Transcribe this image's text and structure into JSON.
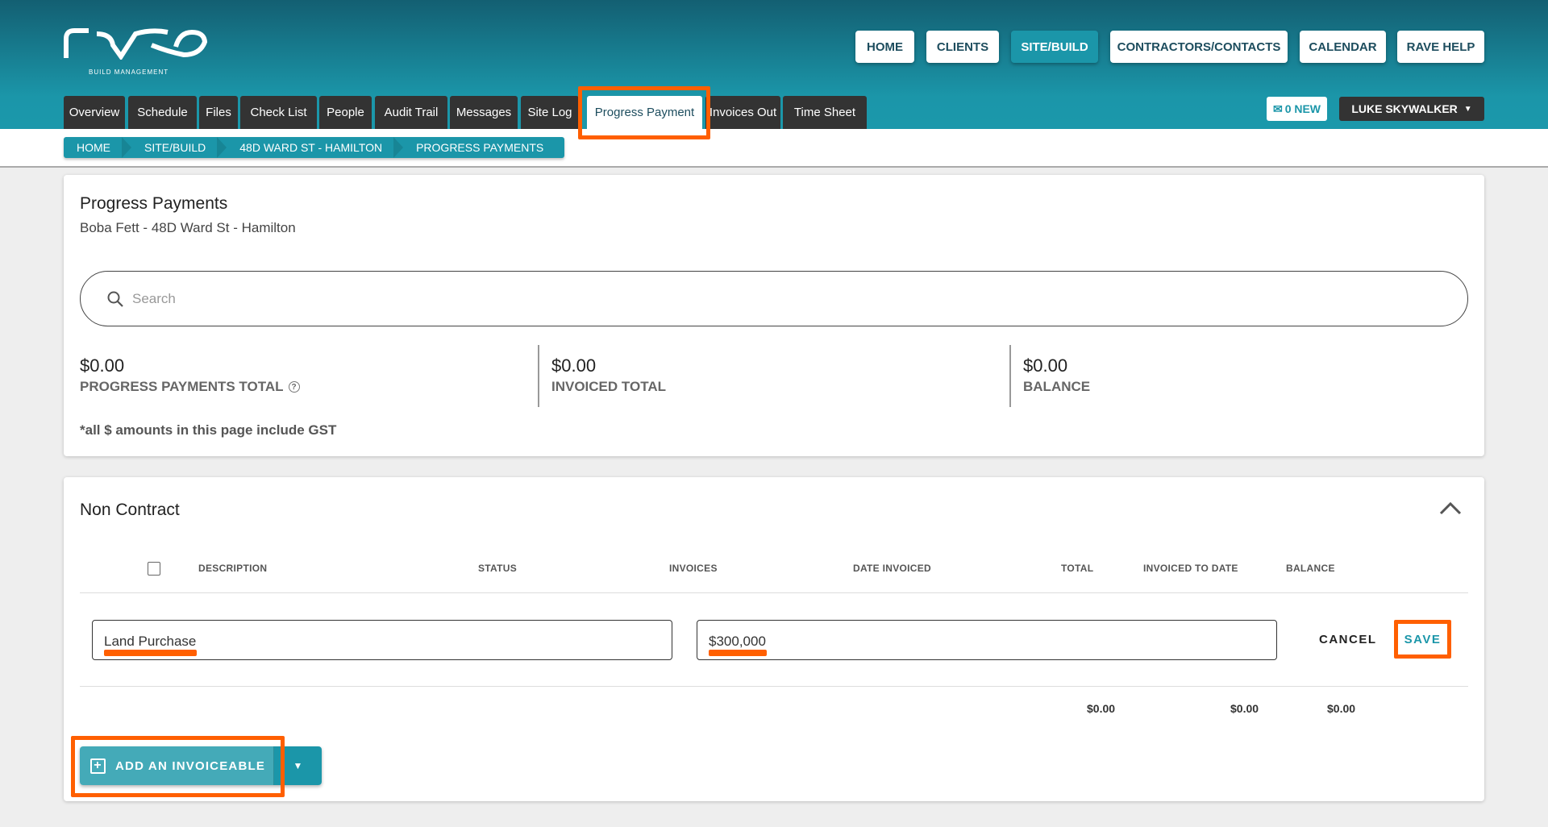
{
  "logo": {
    "text": "rave",
    "tagline": "BUILD MANAGEMENT"
  },
  "nav": [
    {
      "label": "HOME"
    },
    {
      "label": "CLIENTS"
    },
    {
      "label": "SITE/BUILD",
      "active": true
    },
    {
      "label": "CONTRACTORS/CONTACTS"
    },
    {
      "label": "CALENDAR"
    },
    {
      "label": "RAVE HELP"
    }
  ],
  "tabs": [
    "Overview",
    "Schedule",
    "Files",
    "Check List",
    "People",
    "Audit Trail",
    "Messages",
    "Site Log",
    "Progress Payment",
    "Invoices Out",
    "Time Sheet"
  ],
  "messages": {
    "label": "0 NEW"
  },
  "user": {
    "name": "LUKE SKYWALKER"
  },
  "breadcrumb": [
    "HOME",
    "SITE/BUILD",
    "48D WARD ST - HAMILTON",
    "PROGRESS PAYMENTS"
  ],
  "summary": {
    "title": "Progress Payments",
    "subtitle": "Boba Fett - 48D Ward St - Hamilton",
    "search_placeholder": "Search",
    "stats": [
      {
        "value": "$0.00",
        "label": "PROGRESS PAYMENTS TOTAL"
      },
      {
        "value": "$0.00",
        "label": "INVOICED TOTAL"
      },
      {
        "value": "$0.00",
        "label": "BALANCE"
      }
    ],
    "note": "*all $ amounts in this page include GST"
  },
  "section": {
    "title": "Non Contract",
    "columns": [
      "DESCRIPTION",
      "STATUS",
      "INVOICES",
      "DATE INVOICED",
      "TOTAL",
      "INVOICED TO DATE",
      "BALANCE"
    ],
    "edit_row": {
      "description": "Land Purchase",
      "amount": "$300,000",
      "cancel": "CANCEL",
      "save": "SAVE"
    },
    "totals": {
      "total": "$0.00",
      "invoiced_to_date": "$0.00",
      "balance": "$0.00"
    },
    "add_button": "ADD AN INVOICEABLE"
  },
  "colors": {
    "accent": "#1b96a9",
    "highlight": "#ff5f00"
  }
}
